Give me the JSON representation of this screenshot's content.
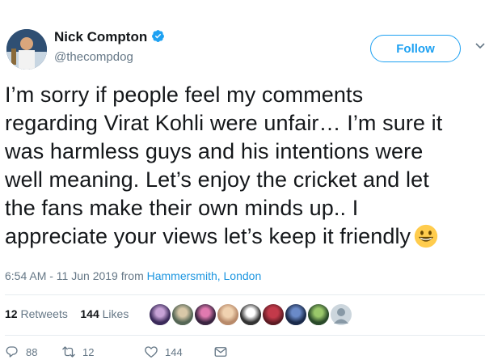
{
  "profile": {
    "name": "Nick Compton",
    "handle": "@thecompdog",
    "verified_icon": "verified-badge-icon",
    "avatar_icon": "avatar"
  },
  "follow_label": "Follow",
  "tweet": {
    "lines": [
      "I’m sorry if people feel my comments",
      "regarding Virat Kohli were unfair… I’m sure it",
      "was harmless guys and his intentions were",
      "well meaning. Let’s enjoy the cricket and let",
      "the fans make their own minds up.. I",
      "appreciate your views let’s keep it friendly"
    ],
    "emoji": "grinning-face-icon"
  },
  "meta": {
    "time": "6:54 AM - 11 Jun 2019 from ",
    "location": "Hammersmith, London"
  },
  "stats": {
    "retweets_count": "12",
    "retweets_label": "Retweets",
    "likes_count": "144",
    "likes_label": "Likes"
  },
  "actions": {
    "replies": "88",
    "retweets": "12",
    "likes": "144"
  },
  "colors": {
    "accent": "#1da1f2",
    "link": "#1b95e0",
    "muted": "#657786",
    "text": "#14171a"
  }
}
